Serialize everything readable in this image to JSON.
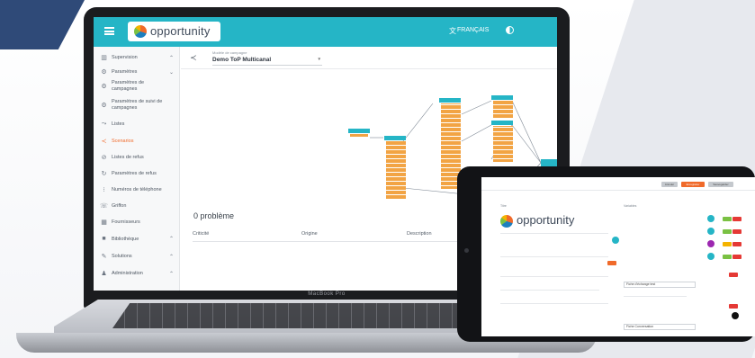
{
  "app": {
    "logo_text": "opportunity",
    "language_label": "FRANÇAIS",
    "language_icon": "translate-icon",
    "theme_icon": "theme-toggle-icon",
    "accent_color": "#25b5c6",
    "active_color": "#f06a2a"
  },
  "laptop": {
    "brand_label": "MacBook Pro"
  },
  "sidebar": {
    "items": [
      {
        "label": "Supervision",
        "icon": "chart-icon",
        "chevron": "^"
      },
      {
        "label": "Paramètres",
        "icon": "gear-icon",
        "chevron": "v"
      },
      {
        "label": "Paramètres de campagnes",
        "icon": "cog-icon",
        "chevron": ""
      },
      {
        "label": "Paramètres de suivi de campagnes",
        "icon": "settings-icon",
        "chevron": ""
      },
      {
        "label": "Listes",
        "icon": "list-icon",
        "chevron": ""
      },
      {
        "label": "Scenarios",
        "icon": "share-icon",
        "chevron": ""
      },
      {
        "label": "Listes de refus",
        "icon": "block-icon",
        "chevron": ""
      },
      {
        "label": "Paramètres de refus",
        "icon": "refresh-icon",
        "chevron": ""
      },
      {
        "label": "Numéros de téléphone",
        "icon": "dialpad-icon",
        "chevron": ""
      },
      {
        "label": "Griffon",
        "icon": "phone-icon",
        "chevron": ""
      },
      {
        "label": "Fournisseurs",
        "icon": "grid-icon",
        "chevron": ""
      },
      {
        "label": "Bibliothèque",
        "icon": "folder-icon",
        "chevron": "^"
      },
      {
        "label": "Solutions",
        "icon": "wrench-icon",
        "chevron": "^"
      },
      {
        "label": "Administration",
        "icon": "people-icon",
        "chevron": "^"
      }
    ]
  },
  "toolbar": {
    "campaign_small_label": "Modèle de campagne",
    "campaign_value": "Demo ToP Multicanal"
  },
  "main": {
    "problems_label": "0 problème",
    "columns": [
      "Criticité",
      "Origine",
      "Description"
    ]
  },
  "tablet": {
    "logo_text": "opportunity",
    "header_buttons": [
      "Annuler",
      "Enregistrer",
      "Sauvegarder"
    ],
    "section_left": "Titre",
    "section_right": "Variables",
    "field_1": "Fiche d'échange test",
    "field_2": "Fiche Conversation"
  }
}
